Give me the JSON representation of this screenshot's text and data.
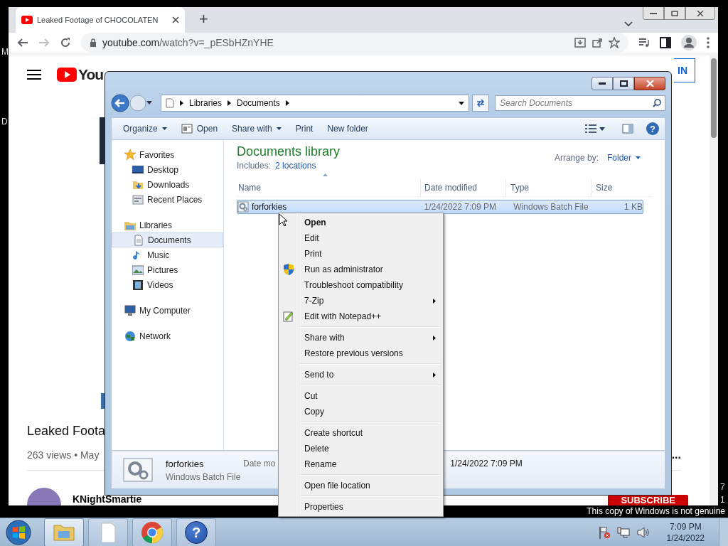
{
  "desktop": {
    "left_edge": [
      "M",
      "D"
    ],
    "right_edge": [
      "7",
      "1"
    ],
    "notice": "This copy of Windows is not genuine"
  },
  "browser": {
    "tab_title": "Leaked Footage of CHOCOLATEN",
    "new_tab": "+",
    "url_host": "youtube.com",
    "url_path": "/watch?v=_pESbHZnYHE"
  },
  "youtube": {
    "logo": "You",
    "sign_in": "IN",
    "title": "Leaked Foota",
    "meta": "263 views • May",
    "more": "...",
    "channel": "KNightSmartie",
    "subscribe": "SUBSCRIBE"
  },
  "explorer": {
    "breadcrumb": [
      "Libraries",
      "Documents"
    ],
    "search_placeholder": "Search Documents",
    "help_glyph": "?",
    "toolbar": [
      {
        "label": "Organize",
        "kind": "menu"
      },
      {
        "label": "Open",
        "kind": "icon"
      },
      {
        "label": "Share with",
        "kind": "menu"
      },
      {
        "label": "Print",
        "kind": "plain"
      },
      {
        "label": "New folder",
        "kind": "plain"
      }
    ],
    "nav": [
      {
        "label": "Favorites",
        "kind": "star",
        "selected": false,
        "children": [
          {
            "label": "Desktop",
            "kind": "desktop",
            "selected": false
          },
          {
            "label": "Downloads",
            "kind": "downloads",
            "selected": false
          },
          {
            "label": "Recent Places",
            "kind": "recent",
            "selected": false
          }
        ]
      },
      {
        "label": "Libraries",
        "kind": "library",
        "selected": false,
        "children": [
          {
            "label": "Documents",
            "kind": "document",
            "selected": true
          },
          {
            "label": "Music",
            "kind": "music",
            "selected": false
          },
          {
            "label": "Pictures",
            "kind": "pictures",
            "selected": false
          },
          {
            "label": "Videos",
            "kind": "videos",
            "selected": false
          }
        ]
      },
      {
        "label": "My Computer",
        "kind": "computer",
        "selected": false
      },
      {
        "label": "Network",
        "kind": "network",
        "selected": false
      }
    ],
    "library": {
      "title": "Documents library",
      "includes_label": "Includes:",
      "includes_link": "2 locations",
      "arrange_label": "Arrange by:",
      "arrange_value": "Folder"
    },
    "columns": [
      "Name",
      "Date modified",
      "Type",
      "Size"
    ],
    "files": [
      {
        "name": "forforkies",
        "date": "1/24/2022 7:09 PM",
        "type": "Windows Batch File",
        "size": "1 KB",
        "selected": true
      }
    ],
    "details": {
      "name": "forforkies",
      "type": "Windows Batch File",
      "date_label": "Date mo",
      "date_value": "1/24/2022 7:09 PM"
    }
  },
  "context_menu": [
    [
      {
        "label": "Open",
        "kind": "plain",
        "default": true,
        "submenu": false
      },
      {
        "label": "Edit",
        "kind": "plain",
        "default": false,
        "submenu": false
      },
      {
        "label": "Print",
        "kind": "plain",
        "default": false,
        "submenu": false
      },
      {
        "label": "Run as administrator",
        "kind": "shield",
        "default": false,
        "submenu": false
      },
      {
        "label": "Troubleshoot compatibility",
        "kind": "plain",
        "default": false,
        "submenu": false
      },
      {
        "label": "7-Zip",
        "kind": "plain",
        "default": false,
        "submenu": true
      },
      {
        "label": "Edit with Notepad++",
        "kind": "notepad",
        "default": false,
        "submenu": false
      }
    ],
    [
      {
        "label": "Share with",
        "kind": "plain",
        "default": false,
        "submenu": true
      },
      {
        "label": "Restore previous versions",
        "kind": "plain",
        "default": false,
        "submenu": false
      }
    ],
    [
      {
        "label": "Send to",
        "kind": "plain",
        "default": false,
        "submenu": true
      }
    ],
    [
      {
        "label": "Cut",
        "kind": "plain",
        "default": false,
        "submenu": false
      },
      {
        "label": "Copy",
        "kind": "plain",
        "default": false,
        "submenu": false
      }
    ],
    [
      {
        "label": "Create shortcut",
        "kind": "plain",
        "default": false,
        "submenu": false
      },
      {
        "label": "Delete",
        "kind": "plain",
        "default": false,
        "submenu": false
      },
      {
        "label": "Rename",
        "kind": "plain",
        "default": false,
        "submenu": false
      }
    ],
    [
      {
        "label": "Open file location",
        "kind": "plain",
        "default": false,
        "submenu": false
      }
    ],
    [
      {
        "label": "Properties",
        "kind": "plain",
        "default": false,
        "submenu": false
      }
    ]
  ],
  "taskbar": {
    "apps": [
      {
        "kind": "explorer",
        "selected": true
      },
      {
        "kind": "document",
        "selected": false
      },
      {
        "kind": "chrome",
        "selected": false
      },
      {
        "kind": "help",
        "selected": false,
        "glyph": "?"
      }
    ],
    "time": "7:09 PM",
    "date": "1/24/2022"
  }
}
